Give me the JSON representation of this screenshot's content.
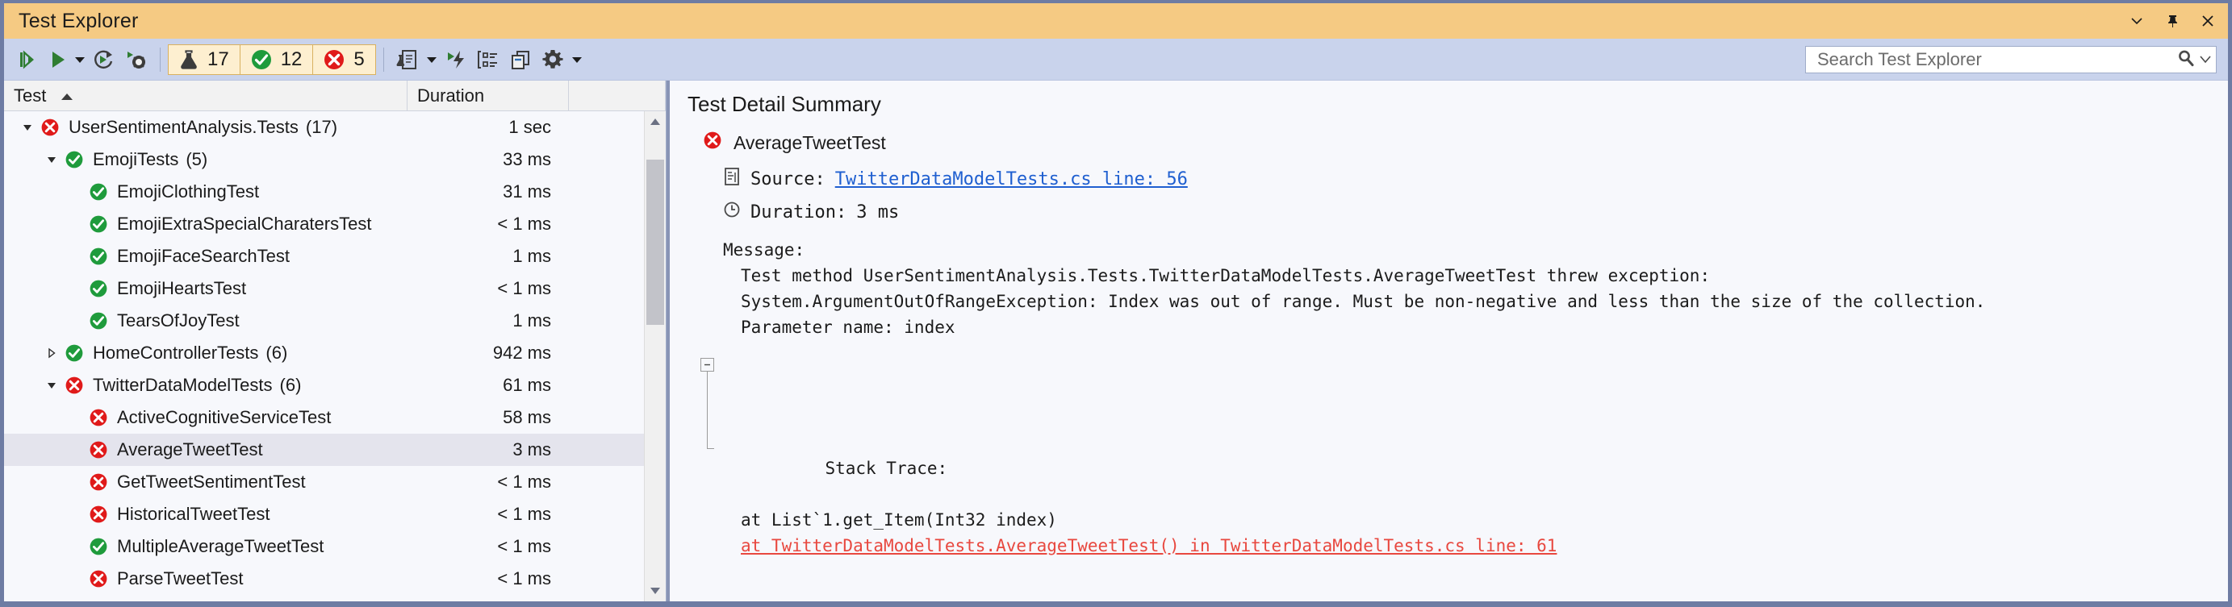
{
  "window": {
    "title": "Test Explorer",
    "controls": [
      "dropdown-chevron",
      "pin",
      "close"
    ]
  },
  "toolbar": {
    "buttons": [
      {
        "name": "run-all-tests",
        "label": "Run All Tests"
      },
      {
        "name": "run-selected-tests",
        "label": "Run"
      },
      {
        "name": "run-dropdown",
        "label": "Run options"
      },
      {
        "name": "repeat-last-run",
        "label": "Repeat Last Run"
      },
      {
        "name": "debug-tests",
        "label": "Debug"
      },
      {
        "name": "test-playlist",
        "label": "Playlist"
      },
      {
        "name": "playlist-dropdown",
        "label": "Playlist options"
      },
      {
        "name": "run-after-build",
        "label": "Run Tests After Build"
      },
      {
        "name": "group-by",
        "label": "Group By"
      },
      {
        "name": "show-test-output",
        "label": "Open Additional Output"
      },
      {
        "name": "settings",
        "label": "Settings"
      },
      {
        "name": "settings-dropdown",
        "label": "Settings options"
      }
    ],
    "counters": [
      {
        "name": "total",
        "icon": "flask-icon",
        "value": "17",
        "color": "#3c3c3c"
      },
      {
        "name": "passed",
        "icon": "passed-icon",
        "value": "12",
        "color": "#1f9b3c"
      },
      {
        "name": "failed",
        "icon": "failed-icon",
        "value": "5",
        "color": "#e01a1a"
      }
    ]
  },
  "search": {
    "placeholder": "Search Test Explorer",
    "value": ""
  },
  "grid": {
    "columns": [
      {
        "name": "test",
        "label": "Test",
        "sort": "asc"
      },
      {
        "name": "duration",
        "label": "Duration"
      }
    ],
    "rows": [
      {
        "name": "UserSentimentAnalysis.Tests",
        "count": "(17)",
        "duration": "1 sec",
        "status": "failed",
        "indent": 0,
        "twisty": "expanded",
        "selected": false
      },
      {
        "name": "EmojiTests",
        "count": "(5)",
        "duration": "33 ms",
        "status": "passed",
        "indent": 1,
        "twisty": "expanded",
        "selected": false
      },
      {
        "name": "EmojiClothingTest",
        "count": "",
        "duration": "31 ms",
        "status": "passed",
        "indent": 2,
        "twisty": "none",
        "selected": false
      },
      {
        "name": "EmojiExtraSpecialCharatersTest",
        "count": "",
        "duration": "< 1 ms",
        "status": "passed",
        "indent": 2,
        "twisty": "none",
        "selected": false
      },
      {
        "name": "EmojiFaceSearchTest",
        "count": "",
        "duration": "1 ms",
        "status": "passed",
        "indent": 2,
        "twisty": "none",
        "selected": false
      },
      {
        "name": "EmojiHeartsTest",
        "count": "",
        "duration": "< 1 ms",
        "status": "passed",
        "indent": 2,
        "twisty": "none",
        "selected": false
      },
      {
        "name": "TearsOfJoyTest",
        "count": "",
        "duration": "1 ms",
        "status": "passed",
        "indent": 2,
        "twisty": "none",
        "selected": false
      },
      {
        "name": "HomeControllerTests",
        "count": "(6)",
        "duration": "942 ms",
        "status": "passed",
        "indent": 1,
        "twisty": "collapsed",
        "selected": false
      },
      {
        "name": "TwitterDataModelTests",
        "count": "(6)",
        "duration": "61 ms",
        "status": "failed",
        "indent": 1,
        "twisty": "expanded",
        "selected": false
      },
      {
        "name": "ActiveCognitiveServiceTest",
        "count": "",
        "duration": "58 ms",
        "status": "failed",
        "indent": 2,
        "twisty": "none",
        "selected": false
      },
      {
        "name": "AverageTweetTest",
        "count": "",
        "duration": "3 ms",
        "status": "failed",
        "indent": 2,
        "twisty": "none",
        "selected": true
      },
      {
        "name": "GetTweetSentimentTest",
        "count": "",
        "duration": "< 1 ms",
        "status": "failed",
        "indent": 2,
        "twisty": "none",
        "selected": false
      },
      {
        "name": "HistoricalTweetTest",
        "count": "",
        "duration": "< 1 ms",
        "status": "failed",
        "indent": 2,
        "twisty": "none",
        "selected": false
      },
      {
        "name": "MultipleAverageTweetTest",
        "count": "",
        "duration": "< 1 ms",
        "status": "passed",
        "indent": 2,
        "twisty": "none",
        "selected": false
      },
      {
        "name": "ParseTweetTest",
        "count": "",
        "duration": "< 1 ms",
        "status": "failed",
        "indent": 2,
        "twisty": "none",
        "selected": false
      }
    ]
  },
  "detail": {
    "title": "Test Detail Summary",
    "test_name": "AverageTweetTest",
    "test_status": "failed",
    "source_label": "Source:",
    "source_link": "TwitterDataModelTests.cs line: 56",
    "duration_label": "Duration:",
    "duration_value": "3 ms",
    "message_label": "Message:",
    "message_lines": [
      "Test method UserSentimentAnalysis.Tests.TwitterDataModelTests.AverageTweetTest threw exception:",
      "System.ArgumentOutOfRangeException: Index was out of range. Must be non-negative and less than the size of the collection.",
      "Parameter name: index"
    ],
    "stack_label": "Stack Trace:",
    "stack_line_plain": "at List`1.get_Item(Int32 index)",
    "stack_line_link": "at TwitterDataModelTests.AverageTweetTest() in TwitterDataModelTests.cs line: 61"
  },
  "colors": {
    "title_bar": "#f5ca83",
    "toolbar": "#c9d3ec",
    "window_border": "#6e7ca3",
    "pass_green": "#1f9b3c",
    "fail_red": "#e01a1a",
    "link_blue": "#1f5fd0",
    "link_red": "#e8483f",
    "selection": "#e4e4ed"
  }
}
